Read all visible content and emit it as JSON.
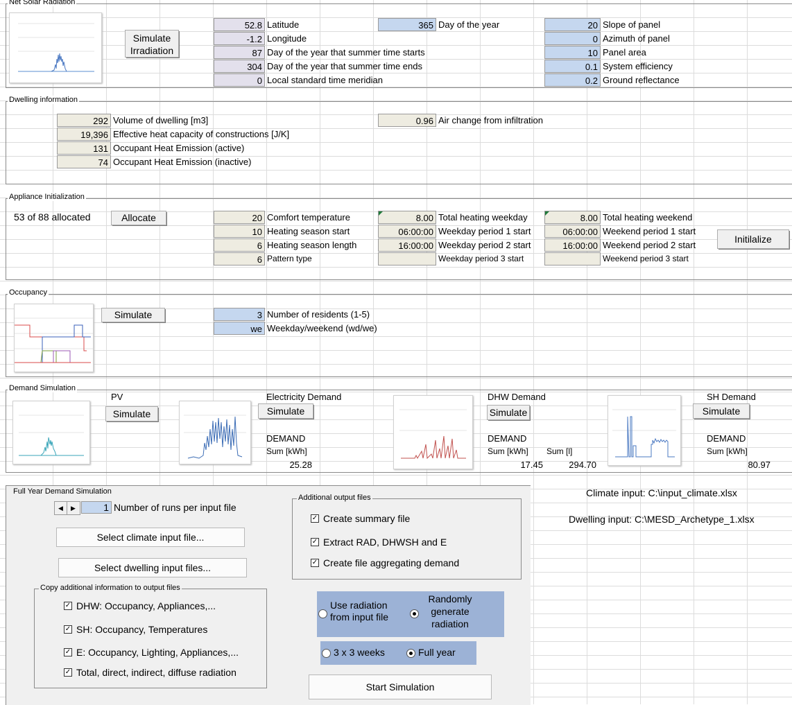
{
  "solar": {
    "title": "Net Solar Radiation",
    "simulate_label": "Simulate Irradiation",
    "latitude": {
      "value": "52.8",
      "label": "Latitude"
    },
    "longitude": {
      "value": "-1.2",
      "label": "Longitude"
    },
    "summer_start": {
      "value": "87",
      "label": "Day of the year that summer time starts"
    },
    "summer_end": {
      "value": "304",
      "label": "Day of the year that summer time ends"
    },
    "meridian": {
      "value": "0",
      "label": "Local standard time meridian"
    },
    "day_of_year": {
      "value": "365",
      "label": "Day of the year"
    },
    "slope": {
      "value": "20",
      "label": "Slope of panel"
    },
    "azimuth": {
      "value": "0",
      "label": "Azimuth of panel"
    },
    "area": {
      "value": "10",
      "label": "Panel area"
    },
    "efficiency": {
      "value": "0.1",
      "label": "System efficiency"
    },
    "reflectance": {
      "value": "0.2",
      "label": "Ground reflectance"
    }
  },
  "dwelling": {
    "title": "Dwelling information",
    "volume": {
      "value": "292",
      "label": "Volume of dwelling [m3]"
    },
    "capacity": {
      "value": "19,396",
      "label": "Effective heat capacity of constructions [J/K]"
    },
    "heat_active": {
      "value": "131",
      "label": "Occupant Heat Emission (active)"
    },
    "heat_inactive": {
      "value": "74",
      "label": "Occupant Heat Emission (inactive)"
    },
    "air_change": {
      "value": "0.96",
      "label": "Air change from infiltration"
    }
  },
  "appliance": {
    "title": "Appliance Initialization",
    "allocated": "53 of 88 allocated",
    "allocate_label": "Allocate",
    "initialize_label": "Initilalize",
    "comfort": {
      "value": "20",
      "label": "Comfort temperature"
    },
    "season_start": {
      "value": "10",
      "label": "Heating season start"
    },
    "season_length": {
      "value": "6",
      "label": "Heating season length"
    },
    "pattern": {
      "value": "6",
      "label": "Pattern type"
    },
    "total_wd": {
      "value": "8.00",
      "label": "Total heating weekday"
    },
    "wd_p1": {
      "value": "06:00:00",
      "label": "Weekday period 1 start"
    },
    "wd_p2": {
      "value": "16:00:00",
      "label": "Weekday period 2 start"
    },
    "wd_p3": {
      "value": "",
      "label": "Weekday period 3 start"
    },
    "total_we": {
      "value": "8.00",
      "label": "Total heating weekend"
    },
    "we_p1": {
      "value": "06:00:00",
      "label": "Weekend period 1 start"
    },
    "we_p2": {
      "value": "16:00:00",
      "label": "Weekend period 2 start"
    },
    "we_p3": {
      "value": "",
      "label": "Weekend period 3 start"
    }
  },
  "occupancy": {
    "title": "Occupancy",
    "simulate_label": "Simulate",
    "residents": {
      "value": "3",
      "label": "Number of residents (1-5)"
    },
    "daytype": {
      "value": "we",
      "label": "Weekday/weekend (wd/we)"
    }
  },
  "demand": {
    "title": "Demand Simulation",
    "pv_label": "PV",
    "simulate_label": "Simulate",
    "elec": {
      "title": "Electricity Demand",
      "demand": "DEMAND",
      "sum_label": "Sum [kWh]",
      "sum": "25.28"
    },
    "dhw": {
      "title": "DHW Demand",
      "demand": "DEMAND",
      "sum_label": "Sum [kWh]",
      "sum": "17.45",
      "sum_l_label": "Sum [l]",
      "sum_l": "294.70"
    },
    "sh": {
      "title": "SH Demand",
      "demand": "DEMAND",
      "sum_label": "Sum [kWh]",
      "sum": "80.97"
    }
  },
  "fullyear": {
    "title": "Full Year Demand Simulation",
    "runs": {
      "value": "1",
      "label": "Number of runs per input file"
    },
    "select_climate": "Select climate input file...",
    "select_dwelling": "Select dwelling input files...",
    "copy_title": "Copy additional information to output files",
    "copy_items": [
      {
        "label": "DHW: Occupancy, Appliances,...",
        "checked": true
      },
      {
        "label": "SH: Occupancy, Temperatures",
        "checked": true
      },
      {
        "label": "E: Occupancy, Lighting, Appliances,...",
        "checked": true
      },
      {
        "label": "Total, direct, indirect, diffuse radiation",
        "checked": true
      }
    ],
    "output_title": "Additional output files",
    "output_items": [
      {
        "label": "Create summary file",
        "checked": true
      },
      {
        "label": "Extract RAD, DHWSH and E",
        "checked": true
      },
      {
        "label": "Create file aggregating demand",
        "checked": true
      }
    ],
    "radio_use": "Use radiation from input file",
    "radio_random": "Randomly generate radiation",
    "radio_3x3": "3 x 3 weeks",
    "radio_full": "Full year",
    "start_label": "Start Simulation",
    "climate_input": "Climate input: C:\\input_climate.xlsx",
    "dwelling_input": "Dwelling input: C:\\MESD_Archetype_1.xlsx"
  },
  "colors": {
    "lavender": "#e3e0ec",
    "blue": "#c5d7ef",
    "beige": "#eeece1",
    "option_blue": "#9cb2d6",
    "pv_line": "#3aa6b9",
    "elec_line": "#3b6cb5",
    "dhw_line": "#c0504d",
    "sh_line": "#4a78c2"
  }
}
